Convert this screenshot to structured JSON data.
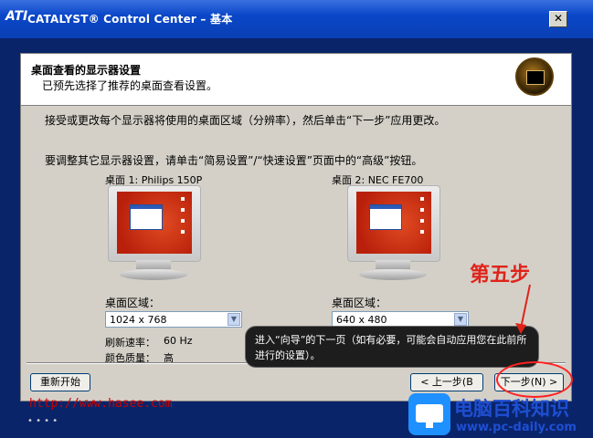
{
  "window": {
    "logo": "ATI",
    "title": "CATALYST® Control Center – 基本",
    "close_label": "✕"
  },
  "header": {
    "title": "桌面查看的显示器设置",
    "subtitle": "已预先选择了推荐的桌面查看设置。"
  },
  "body": {
    "line1": "接受或更改每个显示器将使用的桌面区域（分辨率），然后单击“下一步”应用更改。",
    "line2": "要调整其它显示器设置，请单击“简易设置”/“快速设置”页面中的“高级”按钮。"
  },
  "monitors": [
    {
      "label": "桌面 1: Philips 150P",
      "area_label": "桌面区域：",
      "resolution": "1024 x 768",
      "refresh_label": "刷新速率：",
      "refresh_value": "60 Hz",
      "color_label": "颜色质量：",
      "color_value": "高"
    },
    {
      "label": "桌面 2: NEC FE700",
      "area_label": "桌面区域：",
      "resolution": "640 x 480"
    }
  ],
  "buttons": {
    "restart": "重新开始",
    "back": "< 上一步(B",
    "next": "下一步(N) >"
  },
  "tooltip": {
    "text": "进入“向导”的下一页（如有必要，可能会自动应用您在此前所进行的设置）。"
  },
  "annotation": {
    "step": "第五步",
    "url": "http://www.hasee.com"
  },
  "watermark": {
    "title": "电脑百科知识",
    "url": "www.pc-daily.com"
  },
  "colors": {
    "title_bar": "#0a47c8",
    "annotation_red": "#e0231a",
    "watermark_blue": "#1e4fd2"
  }
}
